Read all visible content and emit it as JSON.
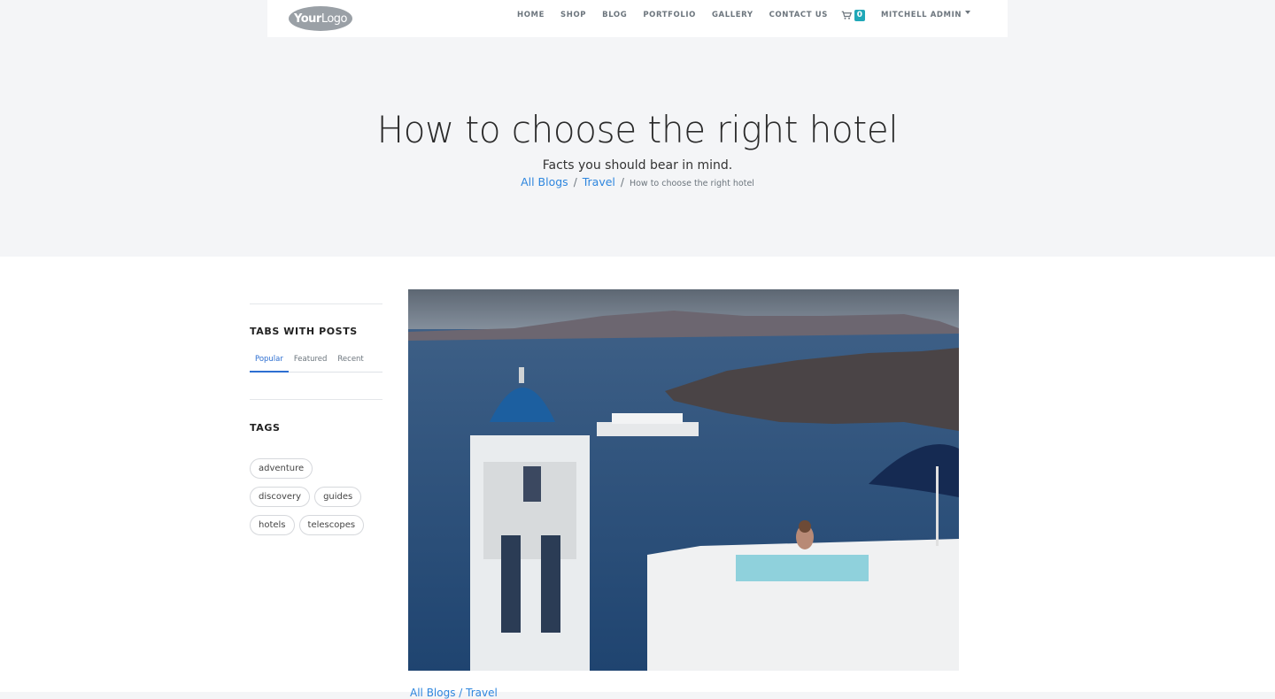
{
  "header": {
    "logo": {
      "bold": "Your",
      "light": "Logo"
    },
    "menu": [
      "HOME",
      "SHOP",
      "BLOG",
      "PORTFOLIO",
      "GALLERY",
      "CONTACT US"
    ],
    "cart_count": "0",
    "user": "MITCHELL ADMIN"
  },
  "hero": {
    "title": "How to choose the right hotel",
    "subtitle": "Facts you should bear in mind.",
    "breadcrumb": {
      "all_blogs": "All Blogs",
      "category": "Travel",
      "current": "How to choose the right hotel",
      "separator": "/"
    }
  },
  "sidebar": {
    "tabs_title": "TABS WITH POSTS",
    "tabs": [
      "Popular",
      "Featured",
      "Recent"
    ],
    "active_tab": "Popular",
    "tags_title": "TAGS",
    "tags": [
      "adventure",
      "discovery",
      "guides",
      "hotels",
      "telescopes"
    ]
  },
  "content": {
    "bottom_link": "All Blogs / Travel"
  },
  "colors": {
    "link": "#2e86de",
    "cart_badge": "#20a8b8",
    "active_tab": "#2d6fd1",
    "hero_bg": "#f4f5f7"
  }
}
